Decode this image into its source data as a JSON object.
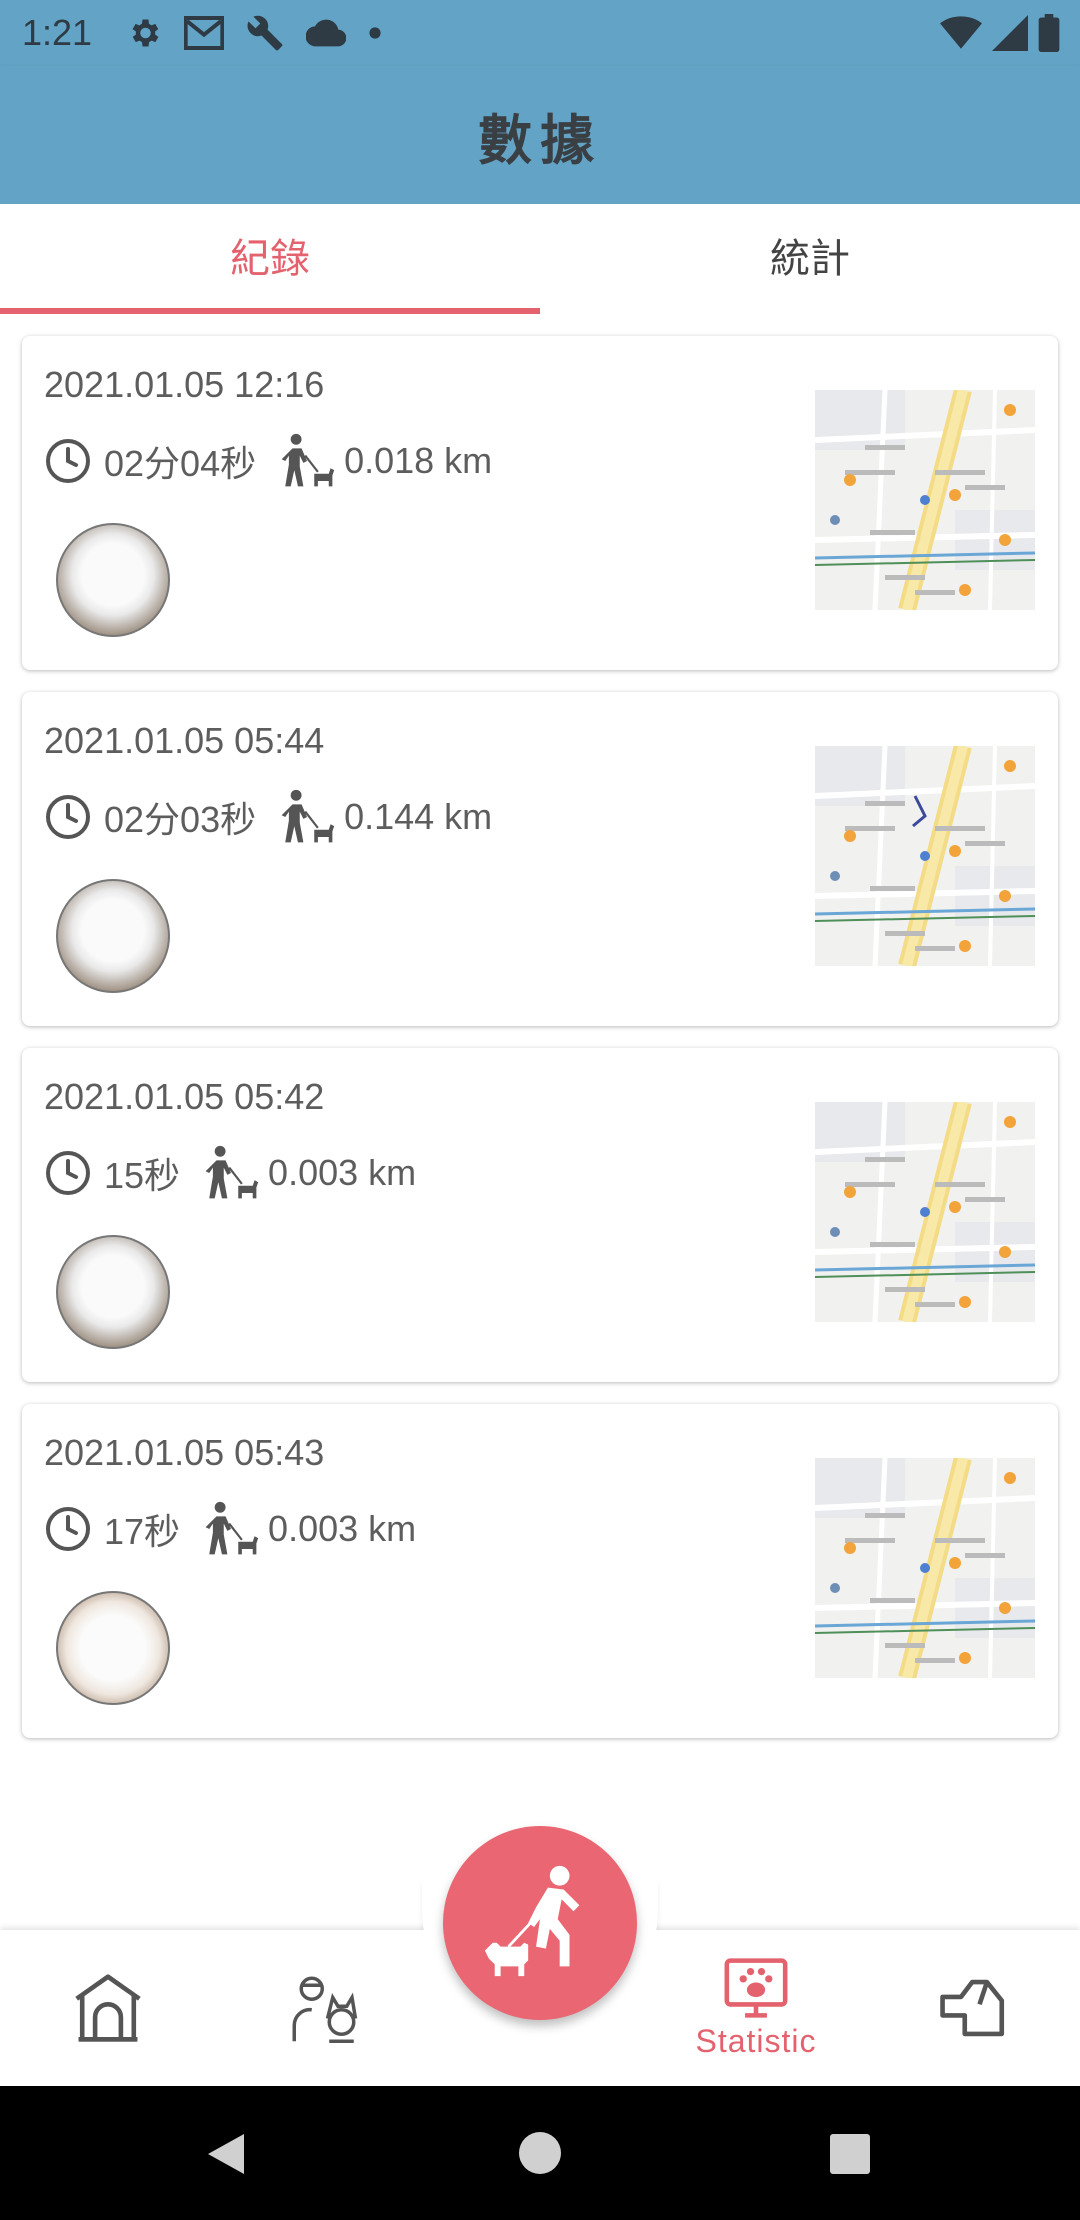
{
  "status_bar": {
    "time": "1:21",
    "left_icons": [
      "gear-icon",
      "gmail-icon",
      "wrench-icon",
      "cloud-icon",
      "dot-icon"
    ],
    "right_icons": [
      "wifi-icon",
      "signal-icon",
      "battery-icon"
    ]
  },
  "app_bar": {
    "title": "數據"
  },
  "tabs": [
    {
      "label": "紀錄",
      "selected": true
    },
    {
      "label": "統計",
      "selected": false
    }
  ],
  "records": [
    {
      "datetime": "2021.01.05 12:16",
      "duration": "02分04秒",
      "distance": "0.018 km"
    },
    {
      "datetime": "2021.01.05 05:44",
      "duration": "02分03秒",
      "distance": "0.144 km"
    },
    {
      "datetime": "2021.01.05 05:42",
      "duration": "15秒",
      "distance": "0.003 km"
    },
    {
      "datetime": "2021.01.05 05:43",
      "duration": "17秒",
      "distance": "0.003 km"
    }
  ],
  "bottom_nav": {
    "items": [
      {
        "icon": "dog-house-icon",
        "label": ""
      },
      {
        "icon": "owner-with-dog-icon",
        "label": ""
      },
      {
        "icon": "paw-board-icon",
        "label": "Statistic",
        "selected": true
      },
      {
        "icon": "dog-head-icon",
        "label": ""
      }
    ],
    "fab_icon": "walk-dog-icon"
  },
  "colors": {
    "app_bar": "#63a4c6",
    "accent": "#e4626e",
    "fab": "#e96672",
    "text": "#5d5d5d"
  }
}
